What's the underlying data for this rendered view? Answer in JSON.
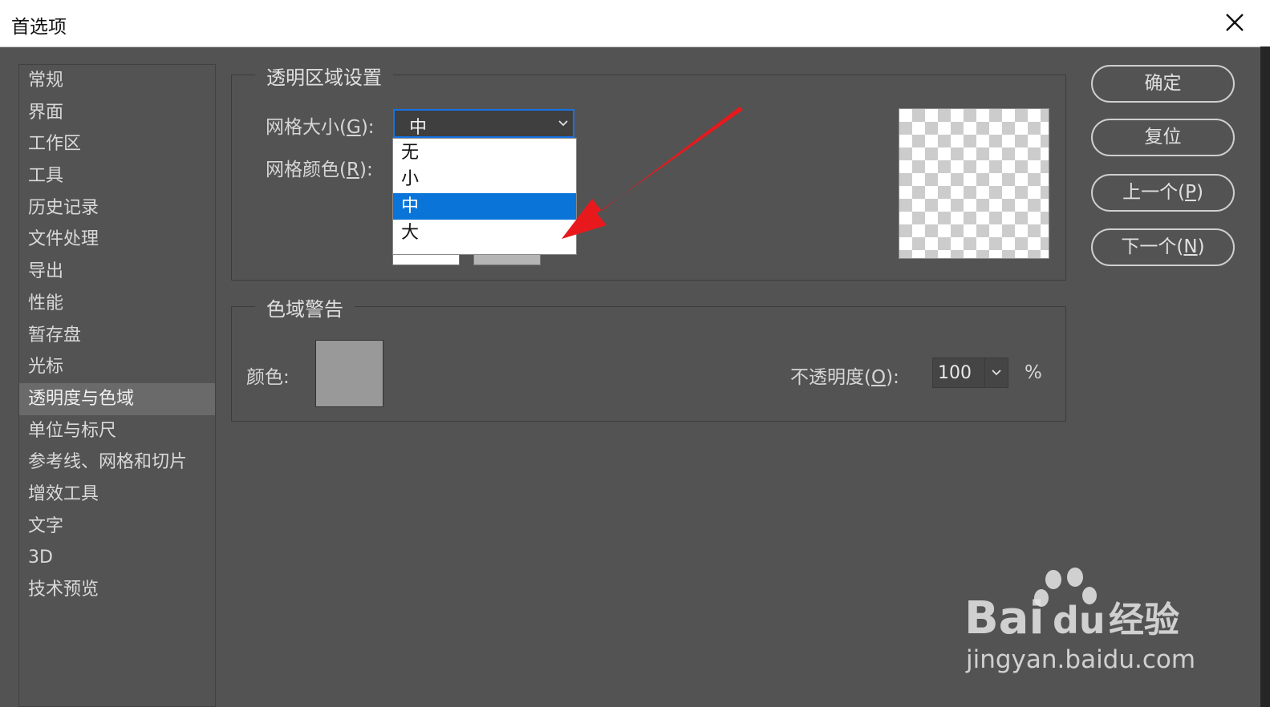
{
  "window": {
    "title": "首选项"
  },
  "sidebar": {
    "items": [
      {
        "label": "常规"
      },
      {
        "label": "界面"
      },
      {
        "label": "工作区"
      },
      {
        "label": "工具"
      },
      {
        "label": "历史记录"
      },
      {
        "label": "文件处理"
      },
      {
        "label": "导出"
      },
      {
        "label": "性能"
      },
      {
        "label": "暂存盘"
      },
      {
        "label": "光标"
      },
      {
        "label": "透明度与色域"
      },
      {
        "label": "单位与标尺"
      },
      {
        "label": "参考线、网格和切片"
      },
      {
        "label": "增效工具"
      },
      {
        "label": "文字"
      },
      {
        "label": "3D"
      },
      {
        "label": "技术预览"
      }
    ],
    "selected": "透明度与色域"
  },
  "transparency": {
    "group_title": "透明区域设置",
    "grid_size_label": "网格大小",
    "grid_size_key": "G",
    "grid_color_label": "网格颜色",
    "grid_color_key": "R",
    "selected_size": "中",
    "options": [
      "无",
      "小",
      "中",
      "大"
    ]
  },
  "gamut": {
    "group_title": "色域警告",
    "color_label": "颜色:",
    "color": "#999999",
    "opacity_label": "不透明度",
    "opacity_key": "O",
    "opacity_value": "100",
    "percent": "%"
  },
  "buttons": {
    "ok": "确定",
    "reset": "复位",
    "prev_label": "上一个",
    "prev_key": "P",
    "next_label": "下一个",
    "next_key": "N"
  },
  "watermark": {
    "brand": "Bai",
    "brand2": "du",
    "cn": "经验",
    "url": "jingyan.baidu.com"
  },
  "colors": {
    "accent": "#1473e6",
    "selection": "#0a74d8",
    "annotation_arrow": "#e8191c",
    "panel_bg": "#535353"
  }
}
